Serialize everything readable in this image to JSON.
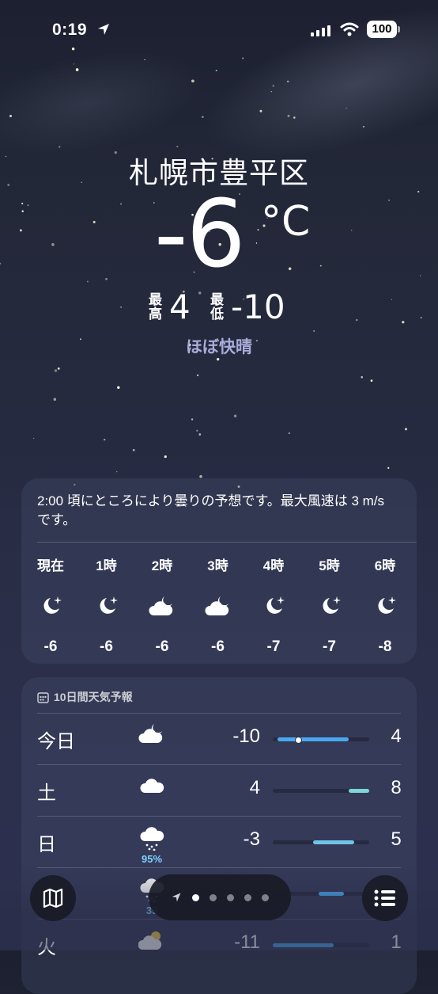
{
  "status_bar": {
    "time": "0:19",
    "battery": "100"
  },
  "location": {
    "name": "札幌市豊平区"
  },
  "current": {
    "temperature": "-6",
    "unit": "°C",
    "high_label": "最高",
    "high": "4",
    "low_label": "最低",
    "low": "-10",
    "condition": "ほぼ快晴"
  },
  "hourly": {
    "summary": "2:00 頃にところにより曇りの予想です。最大風速は 3 m/s です。",
    "hours": [
      {
        "label": "現在",
        "icon": "moon-star-icon",
        "temp": "-6"
      },
      {
        "label": "1時",
        "icon": "moon-star-icon",
        "temp": "-6"
      },
      {
        "label": "2時",
        "icon": "cloud-moon-icon",
        "temp": "-6"
      },
      {
        "label": "3時",
        "icon": "cloud-moon-icon",
        "temp": "-6"
      },
      {
        "label": "4時",
        "icon": "moon-star-icon",
        "temp": "-7"
      },
      {
        "label": "5時",
        "icon": "moon-star-icon",
        "temp": "-7"
      },
      {
        "label": "6時",
        "icon": "moon-star-icon",
        "temp": "-8"
      }
    ]
  },
  "daily": {
    "title": "10日間天気予報",
    "range": [
      -11,
      8
    ],
    "days": [
      {
        "name": "今日",
        "icon": "cloud-moon-icon",
        "precip": "",
        "low": "-10",
        "high": "4",
        "low_val": -10,
        "high_val": 4,
        "current": -6,
        "color": "#4aa8f0"
      },
      {
        "name": "土",
        "icon": "cloud-icon",
        "precip": "",
        "low": "4",
        "high": "8",
        "low_val": 4,
        "high_val": 8,
        "color": "#7fd6d6"
      },
      {
        "name": "日",
        "icon": "cloud-snow-icon",
        "precip": "95%",
        "low": "-3",
        "high": "5",
        "low_val": -3,
        "high_val": 5,
        "color": "#6ec4e6"
      },
      {
        "name": "",
        "icon": "cloud-snow-icon",
        "precip": "35",
        "low": "",
        "high": "",
        "low_val": -2,
        "high_val": 3,
        "color": "#4aa8f0"
      },
      {
        "name": "火",
        "icon": "sun-cloud-icon",
        "precip": "",
        "low": "-11",
        "high": "1",
        "low_val": -11,
        "high_val": 1,
        "color": "#4aa8f0"
      }
    ]
  },
  "pager": {
    "pages": 5,
    "active": 0
  },
  "colors": {
    "accent_condition": "#a8acd8",
    "precip": "#7fd0ff"
  }
}
